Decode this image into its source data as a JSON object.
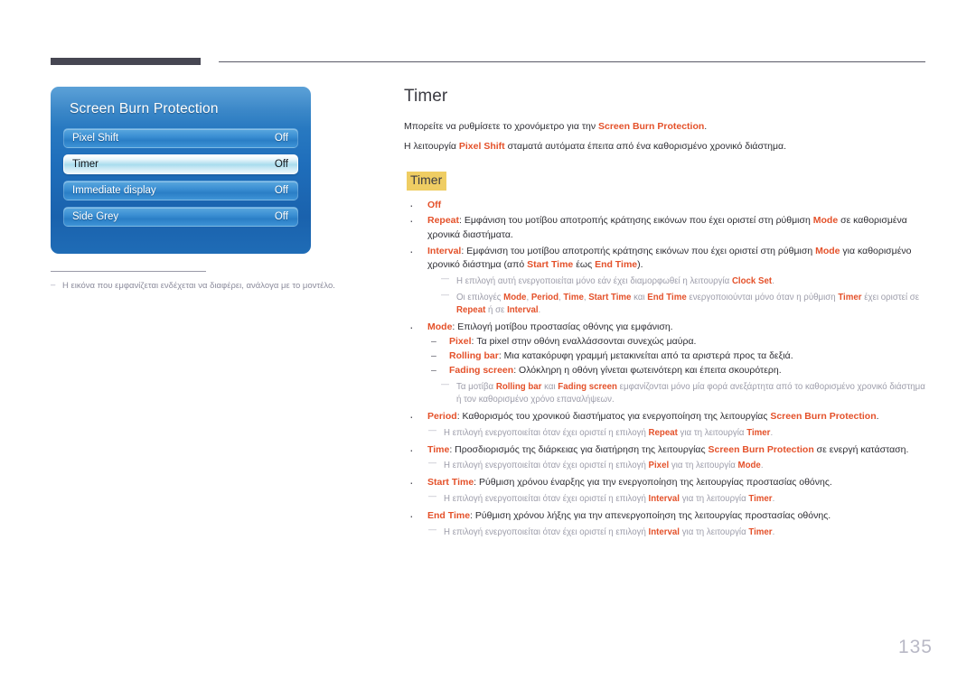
{
  "page": {
    "number": "135"
  },
  "osd": {
    "title": "Screen Burn Protection",
    "rows": [
      {
        "label": "Pixel Shift",
        "value": "Off",
        "selected": false
      },
      {
        "label": "Timer",
        "value": "Off",
        "selected": true
      },
      {
        "label": "Immediate display",
        "value": "Off",
        "selected": false
      },
      {
        "label": "Side Grey",
        "value": "Off",
        "selected": false
      }
    ]
  },
  "left_note": "Η εικόνα που εμφανίζεται ενδέχεται να διαφέρει, ανάλογα με το μοντέλο.",
  "content": {
    "title": "Timer",
    "intro": [
      {
        "pre": "Μπορείτε να ρυθμίσετε το χρονόμετρο για την ",
        "hl": "Screen Burn Protection",
        "post": "."
      },
      {
        "pre": "Η λειτουργία ",
        "hl": "Pixel Shift",
        "post": " σταματά αυτόματα έπειτα από ένα καθορισμένο χρονικό διάστημα."
      }
    ],
    "sub_heading": "Timer",
    "items": {
      "off_label": "Off",
      "repeat_term": "Repeat",
      "repeat_text_a": ": Εμφάνιση του μοτίβου αποτροπής κράτησης εικόνων που έχει οριστεί στη ρύθμιση ",
      "repeat_mode": "Mode",
      "repeat_text_b": " σε καθορισμένα χρονικά διαστήματα.",
      "interval_term": "Interval",
      "interval_text_a": ": Εμφάνιση του μοτίβου αποτροπής κράτησης εικόνων που έχει οριστεί στη ρύθμιση ",
      "interval_mode": "Mode",
      "interval_text_b": " για καθορισμένο χρονικό διάστημα (από ",
      "interval_start": "Start Time",
      "interval_text_c": " έως ",
      "interval_end": "End Time",
      "interval_text_d": ").",
      "note_clock_a": "Η επιλογή αυτή ενεργοποιείται μόνο εάν έχει διαμορφωθεί η λειτουργία ",
      "note_clock_term": "Clock Set",
      "note_clock_b": ".",
      "note_opts_a": "Οι επιλογές ",
      "note_opts_mode": "Mode",
      "note_opts_sep1": ", ",
      "note_opts_period": "Period",
      "note_opts_sep2": ", ",
      "note_opts_time": "Time",
      "note_opts_sep3": ", ",
      "note_opts_start": "Start Time",
      "note_opts_and": " και ",
      "note_opts_end": "End Time",
      "note_opts_b": " ενεργοποιούνται μόνο όταν η ρύθμιση ",
      "note_opts_timer": "Timer",
      "note_opts_c": " έχει οριστεί σε ",
      "note_opts_repeat": "Repeat",
      "note_opts_or": " ή σε ",
      "note_opts_interval": "Interval",
      "note_opts_d": ".",
      "mode_term": "Mode",
      "mode_text": ": Επιλογή μοτίβου προστασίας οθόνης για εμφάνιση.",
      "pixel_term": "Pixel",
      "pixel_text": ": Τα pixel στην οθόνη εναλλάσσονται συνεχώς μαύρα.",
      "rolling_term": "Rolling bar",
      "rolling_text": ": Μια κατακόρυφη γραμμή μετακινείται από τα αριστερά προς τα δεξιά.",
      "fading_term": "Fading screen",
      "fading_text": ": Ολόκληρη η οθόνη γίνεται φωτεινότερη και έπειτα σκουρότερη.",
      "note_patterns_a": "Τα μοτίβα ",
      "note_patterns_rolling": "Rolling bar",
      "note_patterns_and": " και ",
      "note_patterns_fading": "Fading screen",
      "note_patterns_b": " εμφανίζονται μόνο μία φορά ανεξάρτητα από το καθορισμένο χρονικό διάστημα ή τον καθορισμένο χρόνο επαναλήψεων.",
      "period_term": "Period",
      "period_text_a": ": Καθορισμός του χρονικού διαστήματος για ενεργοποίηση της λειτουργίας ",
      "period_sbp": "Screen Burn Protection",
      "period_text_b": ".",
      "note_period_a": "Η επιλογή ενεργοποιείται όταν έχει οριστεί η επιλογή ",
      "note_period_repeat": "Repeat",
      "note_period_b": " για τη λειτουργία ",
      "note_period_timer": "Timer",
      "note_period_c": ".",
      "time_term": "Time",
      "time_text_a": ": Προσδιορισμός της διάρκειας για διατήρηση της λειτουργίας ",
      "time_sbp": "Screen Burn Protection",
      "time_text_b": " σε ενεργή κατάσταση.",
      "note_time_a": "Η επιλογή ενεργοποιείται όταν έχει οριστεί η επιλογή ",
      "note_time_pixel": "Pixel",
      "note_time_b": " για τη λειτουργία ",
      "note_time_mode": "Mode",
      "note_time_c": ".",
      "start_term": "Start Time",
      "start_text": ": Ρύθμιση χρόνου έναρξης για την ενεργοποίηση της λειτουργίας προστασίας οθόνης.",
      "note_start_a": "Η επιλογή ενεργοποιείται όταν έχει οριστεί η επιλογή ",
      "note_start_interval": "Interval",
      "note_start_b": " για τη λειτουργία ",
      "note_start_timer": "Timer",
      "note_start_c": ".",
      "end_term": "End Time",
      "end_text": ": Ρύθμιση χρόνου λήξης για την απενεργοποίηση της λειτουργίας προστασίας οθόνης.",
      "note_end_a": "Η επιλογή ενεργοποιείται όταν έχει οριστεί η επιλογή ",
      "note_end_interval": "Interval",
      "note_end_b": " για τη λειτουργία ",
      "note_end_timer": "Timer",
      "note_end_c": "."
    }
  },
  "colors": {
    "accent": "#e4512a",
    "highlight_bg": "#efcd63",
    "osd_blue": "#1f6ebb",
    "note_gray": "#9d9daa"
  }
}
